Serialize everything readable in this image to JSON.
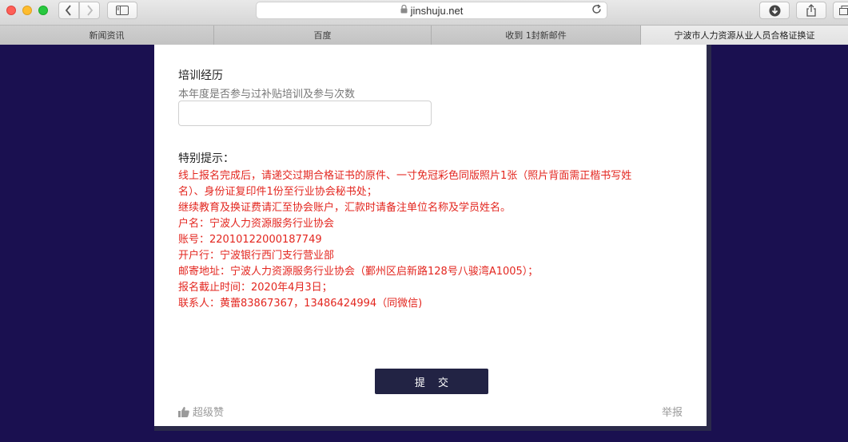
{
  "browser": {
    "url": "jinshuju.net",
    "icons": {
      "back": "chevron-left-icon",
      "forward": "chevron-right-icon",
      "sidebar": "sidebar-icon",
      "lock": "lock-icon",
      "reload": "reload-icon",
      "download": "download-icon",
      "share": "share-icon",
      "tabs": "tabs-icon"
    }
  },
  "tabs": [
    {
      "label": "新闻资讯"
    },
    {
      "label": "百度"
    },
    {
      "label": "收到 1封新邮件"
    },
    {
      "label": "宁波市人力资源从业人员合格证换证"
    }
  ],
  "form": {
    "training": {
      "label": "培训经历",
      "hint": "本年度是否参与过补贴培训及参与次数",
      "value": "",
      "placeholder": ""
    },
    "notice": {
      "title": "特别提示：",
      "lines": [
        "线上报名完成后，请递交过期合格证书的原件、一寸免冠彩色同版照片1张（照片背面需正楷书写姓",
        "名）、身份证复印件1份至行业协会秘书处；",
        "继续教育及换证费请汇至协会账户，汇款时请备注单位名称及学员姓名。",
        "户名：宁波人力资源服务行业协会",
        "账号：22010122000187749",
        "开户行：宁波银行西门支行营业部",
        "邮寄地址：宁波人力资源服务行业协会（鄞州区启新路128号八骏湾A1005）；",
        "报名截止时间：2020年4月3日；",
        "联系人：黄蕾83867367，13486424994（同微信)"
      ]
    },
    "submit_label": "提 交",
    "like_label": "超级赞",
    "report_label": "举报"
  },
  "colors": {
    "background": "#1a1050",
    "notice_text": "#e3261f",
    "submit_bg": "#222344"
  }
}
